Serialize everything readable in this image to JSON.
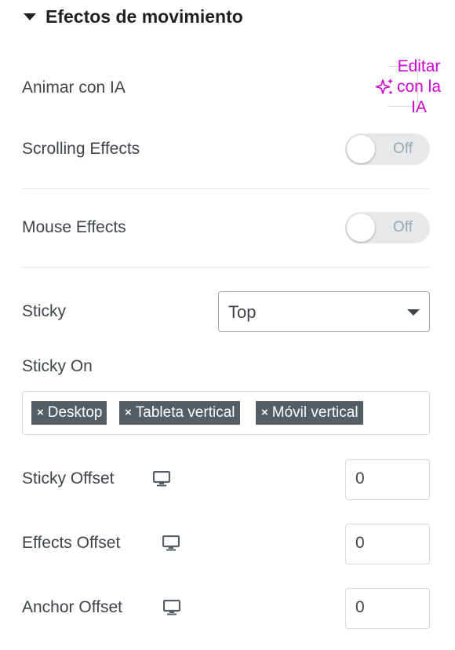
{
  "section": {
    "title": "Efectos de movimiento"
  },
  "ai_animation": {
    "label": "Animar con IA",
    "button_label": "Editar con la IA"
  },
  "scrolling_effects": {
    "label": "Scrolling Effects",
    "toggle_state": "Off"
  },
  "mouse_effects": {
    "label": "Mouse Effects",
    "toggle_state": "Off"
  },
  "sticky": {
    "label": "Sticky",
    "selected": "Top"
  },
  "sticky_on": {
    "label": "Sticky On",
    "tags": [
      "Desktop",
      "Tableta vertical",
      "Móvil vertical"
    ]
  },
  "offsets": [
    {
      "label": "Sticky Offset",
      "value": "0"
    },
    {
      "label": "Effects Offset",
      "value": "0"
    },
    {
      "label": "Anchor Offset",
      "value": "0"
    }
  ],
  "icons": {
    "device": "desktop-monitor-icon",
    "ai": "sparkle-icon",
    "section": "caret-down-icon",
    "tag_remove": "close-icon"
  },
  "colors": {
    "ai_accent": "#d004d4",
    "tag_bg": "#555d65",
    "toggle_off": "#e6e8ea"
  }
}
